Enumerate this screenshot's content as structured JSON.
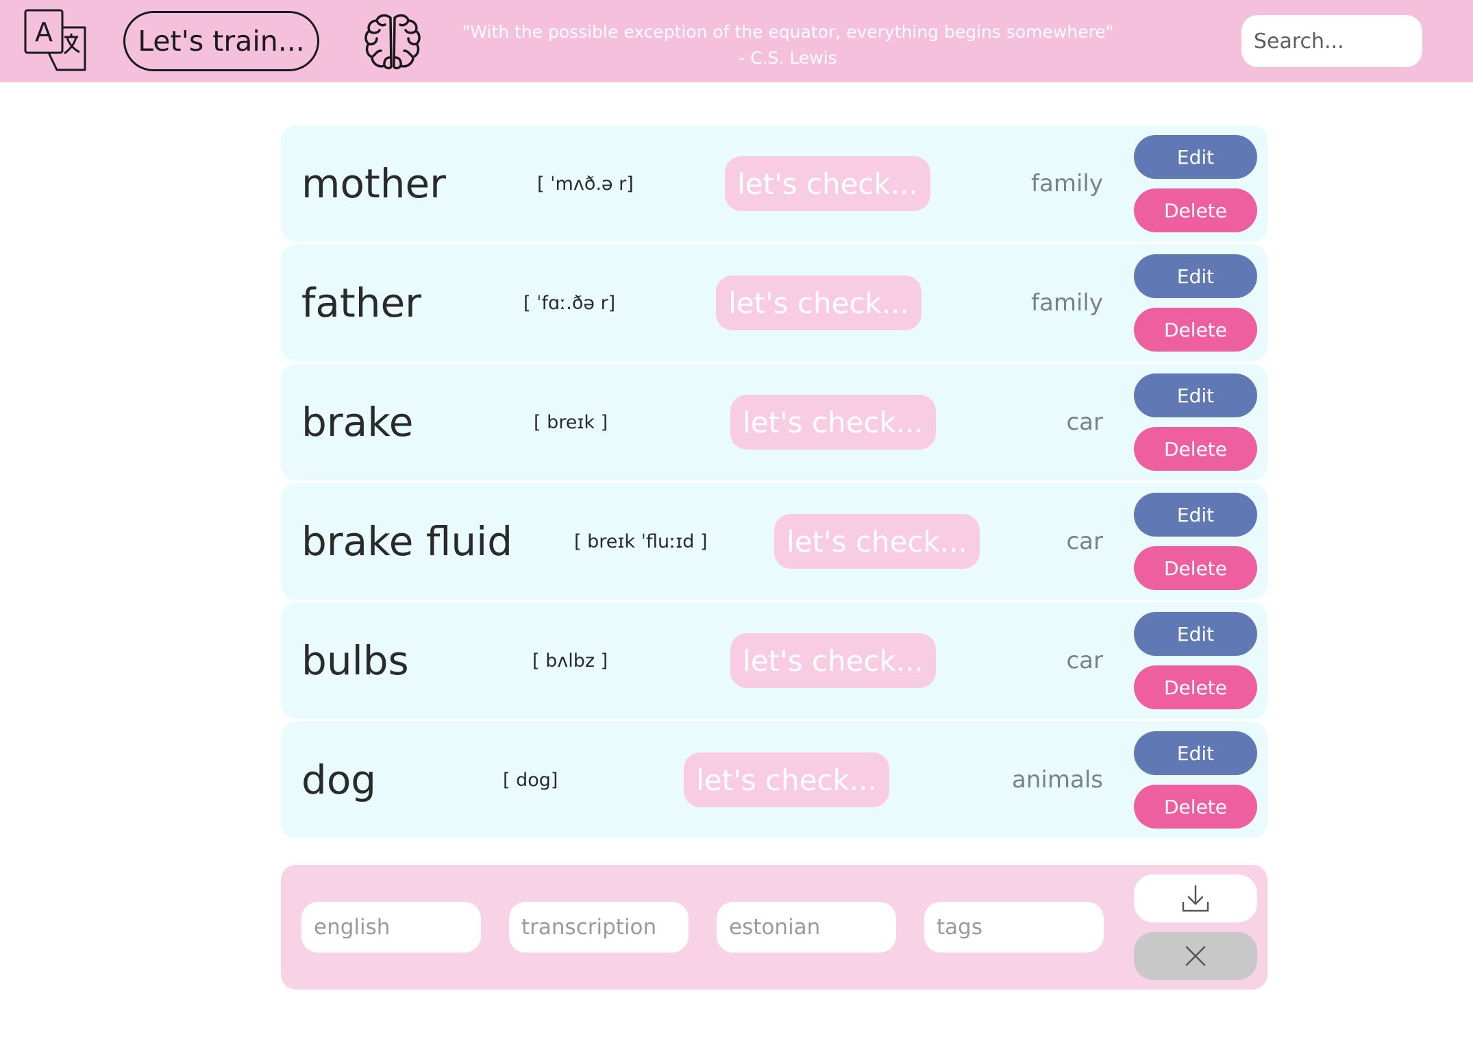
{
  "header": {
    "train_label": "Let's train...",
    "quote_line1": "\"With the possible exception of the equator, everything begins somewhere\"",
    "quote_line2": "- C.S. Lewis",
    "search_placeholder": "Search..."
  },
  "words": [
    {
      "english": "mother",
      "transcription": "[ ˈmʌð.ə r]",
      "check_label": "let's check...",
      "tag": "family",
      "edit_label": "Edit",
      "delete_label": "Delete"
    },
    {
      "english": "father",
      "transcription": "[ ˈfɑː.ðə r]",
      "check_label": "let's check...",
      "tag": "family",
      "edit_label": "Edit",
      "delete_label": "Delete"
    },
    {
      "english": "brake",
      "transcription": "[ breɪk ]",
      "check_label": "let's check...",
      "tag": "car",
      "edit_label": "Edit",
      "delete_label": "Delete"
    },
    {
      "english": "brake fluid",
      "transcription": "[ breɪk ˈfluːɪd ]",
      "check_label": "let's check...",
      "tag": "car",
      "edit_label": "Edit",
      "delete_label": "Delete"
    },
    {
      "english": "bulbs",
      "transcription": "[ bʌlbz ]",
      "check_label": "let's check...",
      "tag": "car",
      "edit_label": "Edit",
      "delete_label": "Delete"
    },
    {
      "english": "dog",
      "transcription": "[ dog]",
      "check_label": "let's check...",
      "tag": "animals",
      "edit_label": "Edit",
      "delete_label": "Delete"
    }
  ],
  "form": {
    "english_placeholder": "english",
    "transcription_placeholder": "transcription",
    "estonian_placeholder": "estonian",
    "tags_placeholder": "tags"
  },
  "icons": {
    "logo": "translate-icon",
    "brain": "brain-icon",
    "save": "download-icon",
    "clear": "close-icon"
  },
  "colors": {
    "header_bg": "#f5c0dc",
    "row_bg": "#eafbfd",
    "check_bg": "#f8cde3",
    "edit_bg": "#6079b5",
    "delete_bg": "#ee5fa0",
    "form_bg": "#f8d3e5"
  }
}
